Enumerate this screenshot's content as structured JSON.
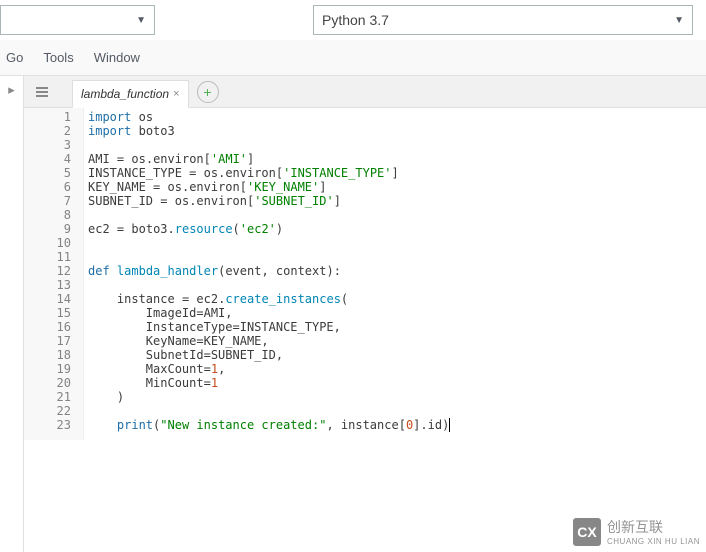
{
  "toolbar": {
    "runtime_label": "Python 3.7"
  },
  "menu": {
    "go": "Go",
    "tools": "Tools",
    "window": "Window"
  },
  "tabs": {
    "file_name": "lambda_function",
    "close_glyph": "×",
    "add_glyph": "+"
  },
  "gutter_start": 1,
  "gutter_end": 23,
  "code_lines": [
    [
      [
        "kw",
        "import"
      ],
      [
        "sp",
        " "
      ],
      [
        "mod",
        "os"
      ]
    ],
    [
      [
        "kw",
        "import"
      ],
      [
        "sp",
        " "
      ],
      [
        "mod",
        "boto3"
      ]
    ],
    [],
    [
      [
        "var",
        "AMI"
      ],
      [
        "sp",
        " "
      ],
      [
        "punct",
        "="
      ],
      [
        "sp",
        " "
      ],
      [
        "mod",
        "os"
      ],
      [
        "punct",
        "."
      ],
      [
        "attr",
        "environ"
      ],
      [
        "punct",
        "["
      ],
      [
        "str",
        "'AMI'"
      ],
      [
        "punct",
        "]"
      ]
    ],
    [
      [
        "var",
        "INSTANCE_TYPE"
      ],
      [
        "sp",
        " "
      ],
      [
        "punct",
        "="
      ],
      [
        "sp",
        " "
      ],
      [
        "mod",
        "os"
      ],
      [
        "punct",
        "."
      ],
      [
        "attr",
        "environ"
      ],
      [
        "punct",
        "["
      ],
      [
        "str",
        "'INSTANCE_TYPE'"
      ],
      [
        "punct",
        "]"
      ]
    ],
    [
      [
        "var",
        "KEY_NAME"
      ],
      [
        "sp",
        " "
      ],
      [
        "punct",
        "="
      ],
      [
        "sp",
        " "
      ],
      [
        "mod",
        "os"
      ],
      [
        "punct",
        "."
      ],
      [
        "attr",
        "environ"
      ],
      [
        "punct",
        "["
      ],
      [
        "str",
        "'KEY_NAME'"
      ],
      [
        "punct",
        "]"
      ]
    ],
    [
      [
        "var",
        "SUBNET_ID"
      ],
      [
        "sp",
        " "
      ],
      [
        "punct",
        "="
      ],
      [
        "sp",
        " "
      ],
      [
        "mod",
        "os"
      ],
      [
        "punct",
        "."
      ],
      [
        "attr",
        "environ"
      ],
      [
        "punct",
        "["
      ],
      [
        "str",
        "'SUBNET_ID'"
      ],
      [
        "punct",
        "]"
      ]
    ],
    [],
    [
      [
        "var",
        "ec2"
      ],
      [
        "sp",
        " "
      ],
      [
        "punct",
        "="
      ],
      [
        "sp",
        " "
      ],
      [
        "mod",
        "boto3"
      ],
      [
        "punct",
        "."
      ],
      [
        "fn",
        "resource"
      ],
      [
        "punct",
        "("
      ],
      [
        "str",
        "'ec2'"
      ],
      [
        "punct",
        ")"
      ]
    ],
    [],
    [],
    [
      [
        "kw",
        "def"
      ],
      [
        "sp",
        " "
      ],
      [
        "fn",
        "lambda_handler"
      ],
      [
        "punct",
        "("
      ],
      [
        "param",
        "event"
      ],
      [
        "punct",
        ","
      ],
      [
        "sp",
        " "
      ],
      [
        "param",
        "context"
      ],
      [
        "punct",
        ")"
      ],
      [
        "punct",
        ":"
      ]
    ],
    [],
    [
      [
        "sp",
        "    "
      ],
      [
        "var",
        "instance"
      ],
      [
        "sp",
        " "
      ],
      [
        "punct",
        "="
      ],
      [
        "sp",
        " "
      ],
      [
        "var",
        "ec2"
      ],
      [
        "punct",
        "."
      ],
      [
        "fn",
        "create_instances"
      ],
      [
        "punct",
        "("
      ]
    ],
    [
      [
        "sp",
        "        "
      ],
      [
        "param",
        "ImageId"
      ],
      [
        "punct",
        "="
      ],
      [
        "var",
        "AMI"
      ],
      [
        "punct",
        ","
      ]
    ],
    [
      [
        "sp",
        "        "
      ],
      [
        "param",
        "InstanceType"
      ],
      [
        "punct",
        "="
      ],
      [
        "var",
        "INSTANCE_TYPE"
      ],
      [
        "punct",
        ","
      ]
    ],
    [
      [
        "sp",
        "        "
      ],
      [
        "param",
        "KeyName"
      ],
      [
        "punct",
        "="
      ],
      [
        "var",
        "KEY_NAME"
      ],
      [
        "punct",
        ","
      ]
    ],
    [
      [
        "sp",
        "        "
      ],
      [
        "param",
        "SubnetId"
      ],
      [
        "punct",
        "="
      ],
      [
        "var",
        "SUBNET_ID"
      ],
      [
        "punct",
        ","
      ]
    ],
    [
      [
        "sp",
        "        "
      ],
      [
        "param",
        "MaxCount"
      ],
      [
        "punct",
        "="
      ],
      [
        "num",
        "1"
      ],
      [
        "punct",
        ","
      ]
    ],
    [
      [
        "sp",
        "        "
      ],
      [
        "param",
        "MinCount"
      ],
      [
        "punct",
        "="
      ],
      [
        "num",
        "1"
      ]
    ],
    [
      [
        "sp",
        "    "
      ],
      [
        "punct",
        ")"
      ]
    ],
    [],
    [
      [
        "sp",
        "    "
      ],
      [
        "builtin",
        "print"
      ],
      [
        "punct",
        "("
      ],
      [
        "str",
        "\"New instance created:\""
      ],
      [
        "punct",
        ","
      ],
      [
        "sp",
        " "
      ],
      [
        "var",
        "instance"
      ],
      [
        "punct",
        "["
      ],
      [
        "num",
        "0"
      ],
      [
        "punct",
        "]"
      ],
      [
        "punct",
        "."
      ],
      [
        "attr",
        "id"
      ],
      [
        "punct",
        ")"
      ]
    ]
  ],
  "watermark": {
    "logo": "CX",
    "text_zh": "创新互联",
    "text_py": "CHUANG XIN HU LIAN"
  }
}
